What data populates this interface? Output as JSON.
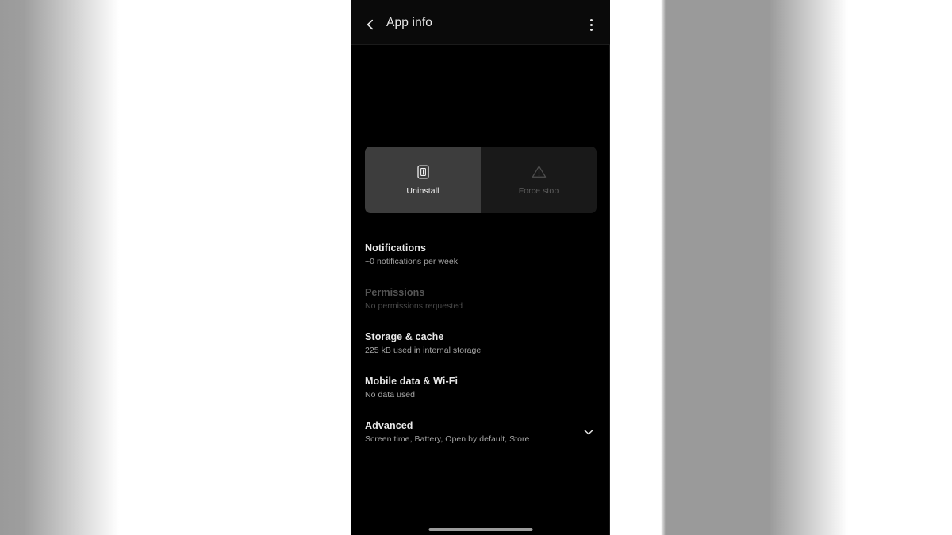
{
  "screen": {
    "platform_theme": "dark",
    "background_color": "#000000"
  },
  "appbar": {
    "title": "App info",
    "back_icon": "chevron-left-icon",
    "overflow_icon": "more-vertical-icon"
  },
  "actions": [
    {
      "label": "Uninstall",
      "icon": "trash-icon",
      "state": "enabled",
      "background_color": "#3d3d3d"
    },
    {
      "label": "Force stop",
      "icon": "warning-triangle-icon",
      "state": "disabled",
      "background_color": "#191919"
    }
  ],
  "settings_rows": [
    {
      "title": "Notifications",
      "subtitle": "~0 notifications per week",
      "state": "enabled",
      "trailing": ""
    },
    {
      "title": "Permissions",
      "subtitle": "No permissions requested",
      "state": "disabled",
      "trailing": ""
    },
    {
      "title": "Storage & cache",
      "subtitle": "225 kB used in internal storage",
      "state": "enabled",
      "trailing": ""
    },
    {
      "title": "Mobile data & Wi-Fi",
      "subtitle": "No data used",
      "state": "enabled",
      "trailing": ""
    },
    {
      "title": "Advanced",
      "subtitle": "Screen time, Battery, Open by default, Store",
      "state": "enabled",
      "trailing": "chevron-down-icon"
    }
  ],
  "navigation": {
    "gesture_bar": "home-gesture-bar"
  }
}
